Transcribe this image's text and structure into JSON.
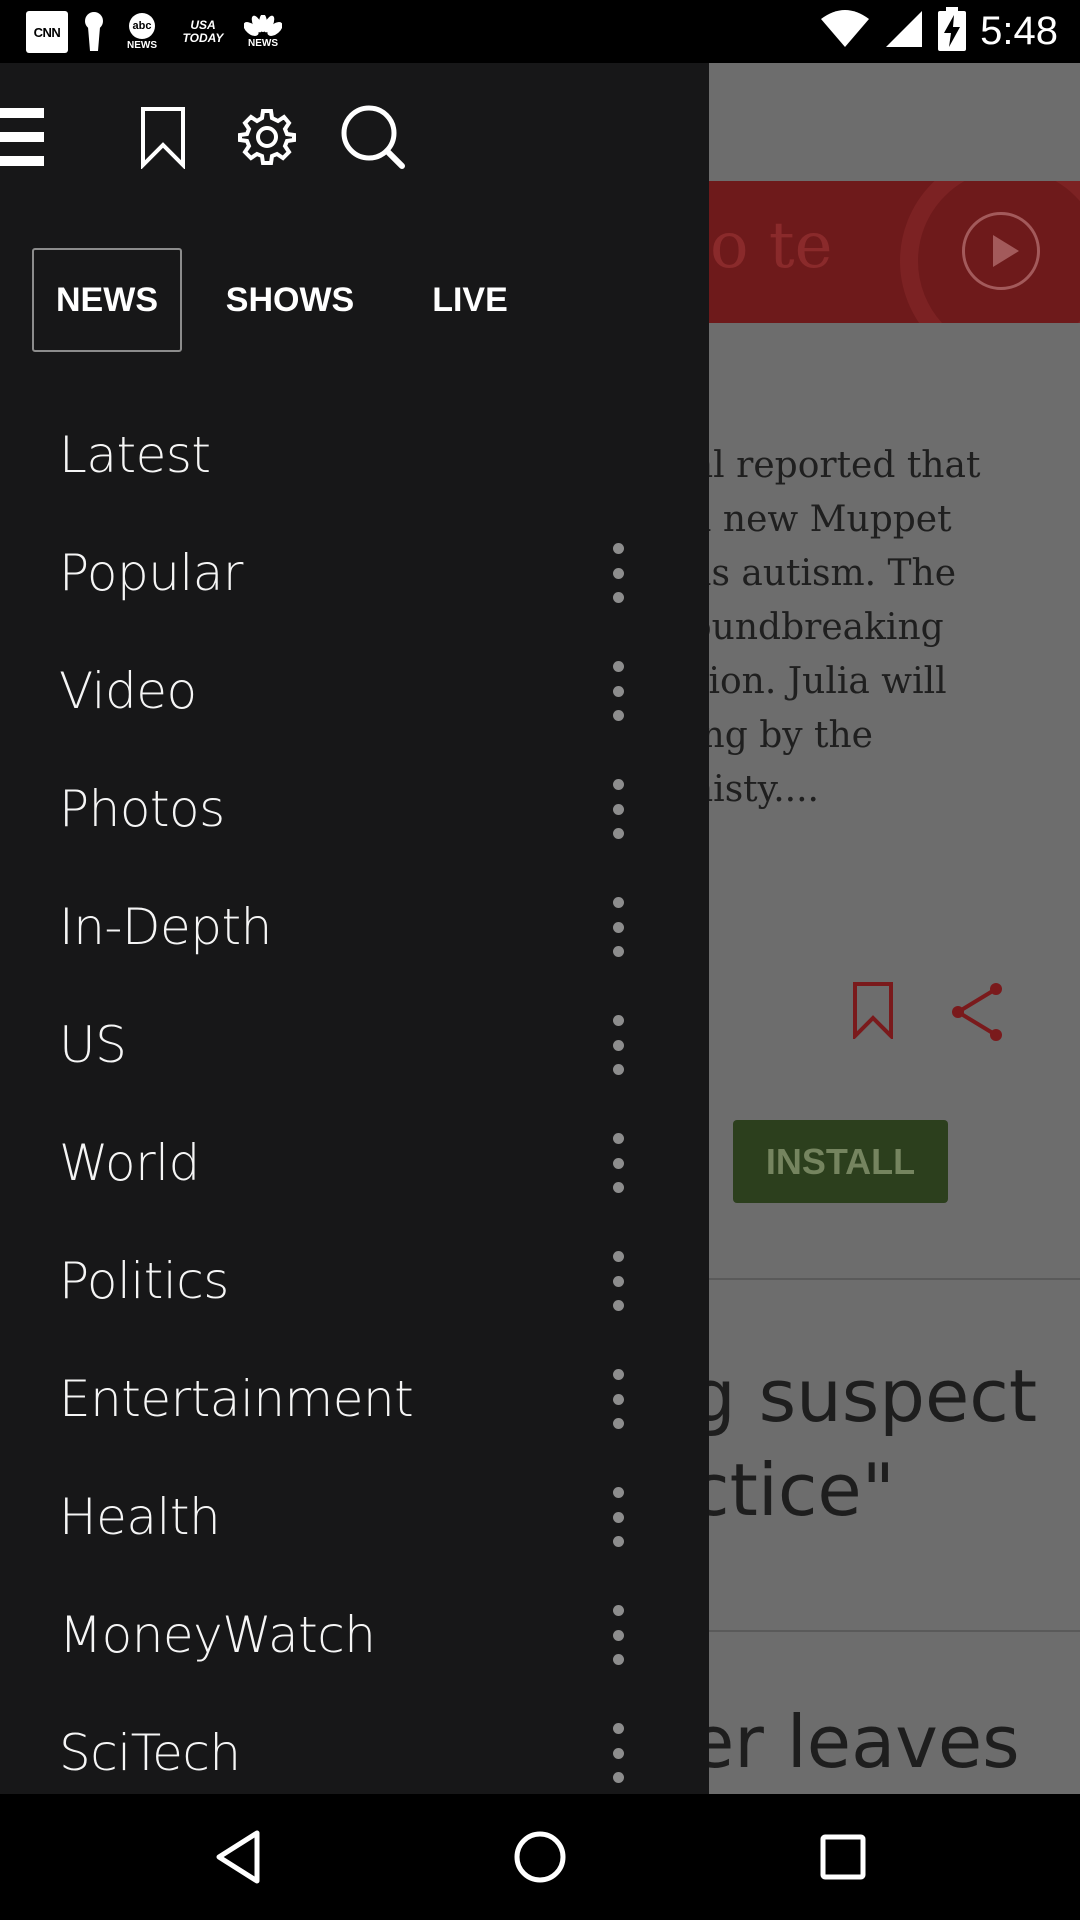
{
  "status_bar": {
    "time": "5:48",
    "notifications": [
      {
        "icon": "cnn-icon",
        "text": "CNN"
      },
      {
        "icon": "keyhole-icon",
        "text": ""
      },
      {
        "icon": "abc-news-icon",
        "text": "abc",
        "subtext": "NEWS"
      },
      {
        "icon": "usa-today-icon",
        "text": "USA",
        "subtext": "TODAY"
      },
      {
        "icon": "nbc-news-icon",
        "text": "NEWS"
      }
    ],
    "system_icons": [
      "wifi-icon",
      "cell-signal-icon",
      "battery-charging-icon"
    ]
  },
  "drawer": {
    "toolbar_icons": [
      "menu-icon",
      "bookmark-icon",
      "settings-icon",
      "search-icon"
    ],
    "tabs": [
      {
        "label": "NEWS",
        "active": true
      },
      {
        "label": "SHOWS",
        "active": false
      },
      {
        "label": "LIVE",
        "active": false
      }
    ],
    "items": [
      {
        "label": "Latest",
        "has_more": false
      },
      {
        "label": "Popular",
        "has_more": true
      },
      {
        "label": "Video",
        "has_more": true
      },
      {
        "label": "Photos",
        "has_more": true
      },
      {
        "label": "In-Depth",
        "has_more": true
      },
      {
        "label": "US",
        "has_more": true
      },
      {
        "label": "World",
        "has_more": true
      },
      {
        "label": "Politics",
        "has_more": true
      },
      {
        "label": "Entertainment",
        "has_more": true
      },
      {
        "label": "Health",
        "has_more": true
      },
      {
        "label": "MoneyWatch",
        "has_more": true
      },
      {
        "label": "SciTech",
        "has_more": true
      }
    ]
  },
  "background": {
    "video_text": "o te",
    "article_lines": [
      "nl reported that",
      "a new Muppet",
      "as autism. The",
      "oundbreaking",
      "sion. Julia will",
      "ing by the",
      "nisty...."
    ],
    "install_label": "INSTALL",
    "headline1": "g suspect\nctice\"",
    "headline2": "er leaves",
    "colors": {
      "accent": "#8b1a1c",
      "install": "#2c3f1d"
    }
  },
  "nav_bar": {
    "buttons": [
      "back-icon",
      "home-icon",
      "recent-apps-icon"
    ]
  }
}
